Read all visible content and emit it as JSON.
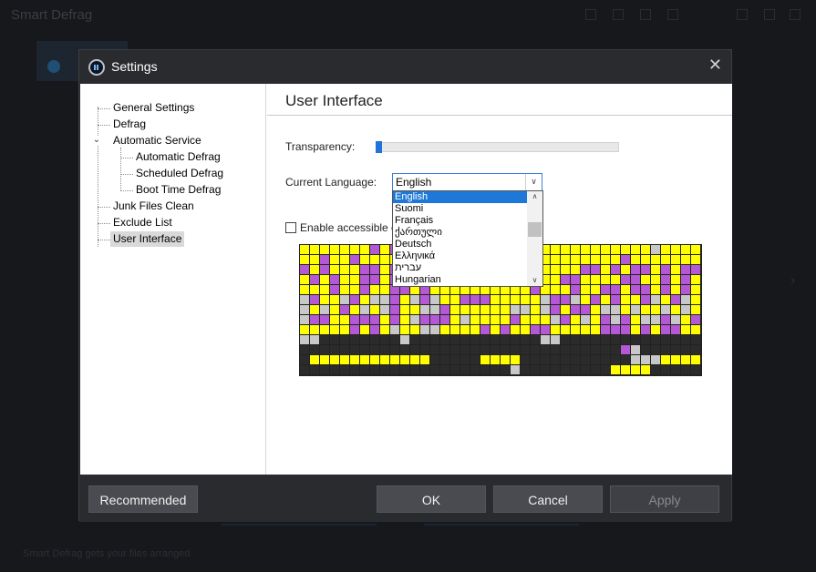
{
  "background": {
    "app_title": "Smart Defrag",
    "bottom_text": "Smart Defrag gets your files arranged"
  },
  "dialog": {
    "title": "Settings",
    "close_glyph": "✕"
  },
  "tree": {
    "items": [
      {
        "label": "General Settings"
      },
      {
        "label": "Defrag"
      },
      {
        "label": "Automatic Service"
      },
      {
        "label": "Automatic Defrag"
      },
      {
        "label": "Scheduled Defrag"
      },
      {
        "label": "Boot Time Defrag"
      },
      {
        "label": "Junk Files Clean"
      },
      {
        "label": "Exclude List"
      },
      {
        "label": "User Interface"
      }
    ],
    "selected": "User Interface"
  },
  "panel": {
    "title": "User Interface",
    "transparency_label": "Transparency:",
    "transparency_value": 0,
    "language_label": "Current Language:",
    "language_value": "English",
    "accessible_label": "Enable accessible c",
    "accessible_checked": false
  },
  "dropdown": {
    "options": [
      "English",
      "Suomi",
      "Français",
      "ქართული",
      "Deutsch",
      "Ελληνικά",
      "עברית",
      "Hungarian"
    ],
    "selected": "English"
  },
  "legend_colors": {
    "yellow": "#ffff00",
    "purple": "#b458d6",
    "gray": "#c8c8c8",
    "dark": "#2b2b2b"
  },
  "disk_map": [
    "YYYYYYYPYPYYYYYYYYYYYYYYYYYYYYYYYYYGYYYY",
    "YYPYYPYYYYYYYYYYYYYYYYYYYYYYYYYYPYYYYYYY",
    "PYPYYYPPYPPPYPPPYYYYYYYYYYYYPPYPYPPYPYPP",
    "YPYPYYPPYPYPPPYYYYYYYYYYYYPPYYYYPPYYPYPY",
    "YYYPYYPYYPPYPYYYYYYYYYYPYYYPYYPPYPPYPYPY",
    "GPYYGPYGGPYGPGYYPPPYYYYYGPPGYPYPYYPGYPGY",
    "GYGYPYGYGPYYGGPYYYYYYGGYGPYPPYGGYGYYGYGY",
    "GPPYYPPPYPYGPPPYGYYYYPYYYGPYGYPGPYGGPGYP",
    "YYYYYPYPYGYYGGYYYYPYPYYPPYYYYYPPPYPYPPYY",
    "GGDDDDDDDDGDDDDDDDDDDDDDGGDDDDDDDDDDDDDD",
    "DDDDDDDDDDDDDDDDDDDDDDDDDDDDDDDDPGDDDDDD",
    "DYYYYYYYYYYYYDDDDDYYYYDDDDDDDDDDDGGGYYYY",
    "DDDDDDDDDDDDDDDDDDDDDGDDDDDDDDDYYYYDDDDD"
  ],
  "footer": {
    "recommended_label": "Recommended",
    "ok_label": "OK",
    "cancel_label": "Cancel",
    "apply_label": "Apply"
  }
}
